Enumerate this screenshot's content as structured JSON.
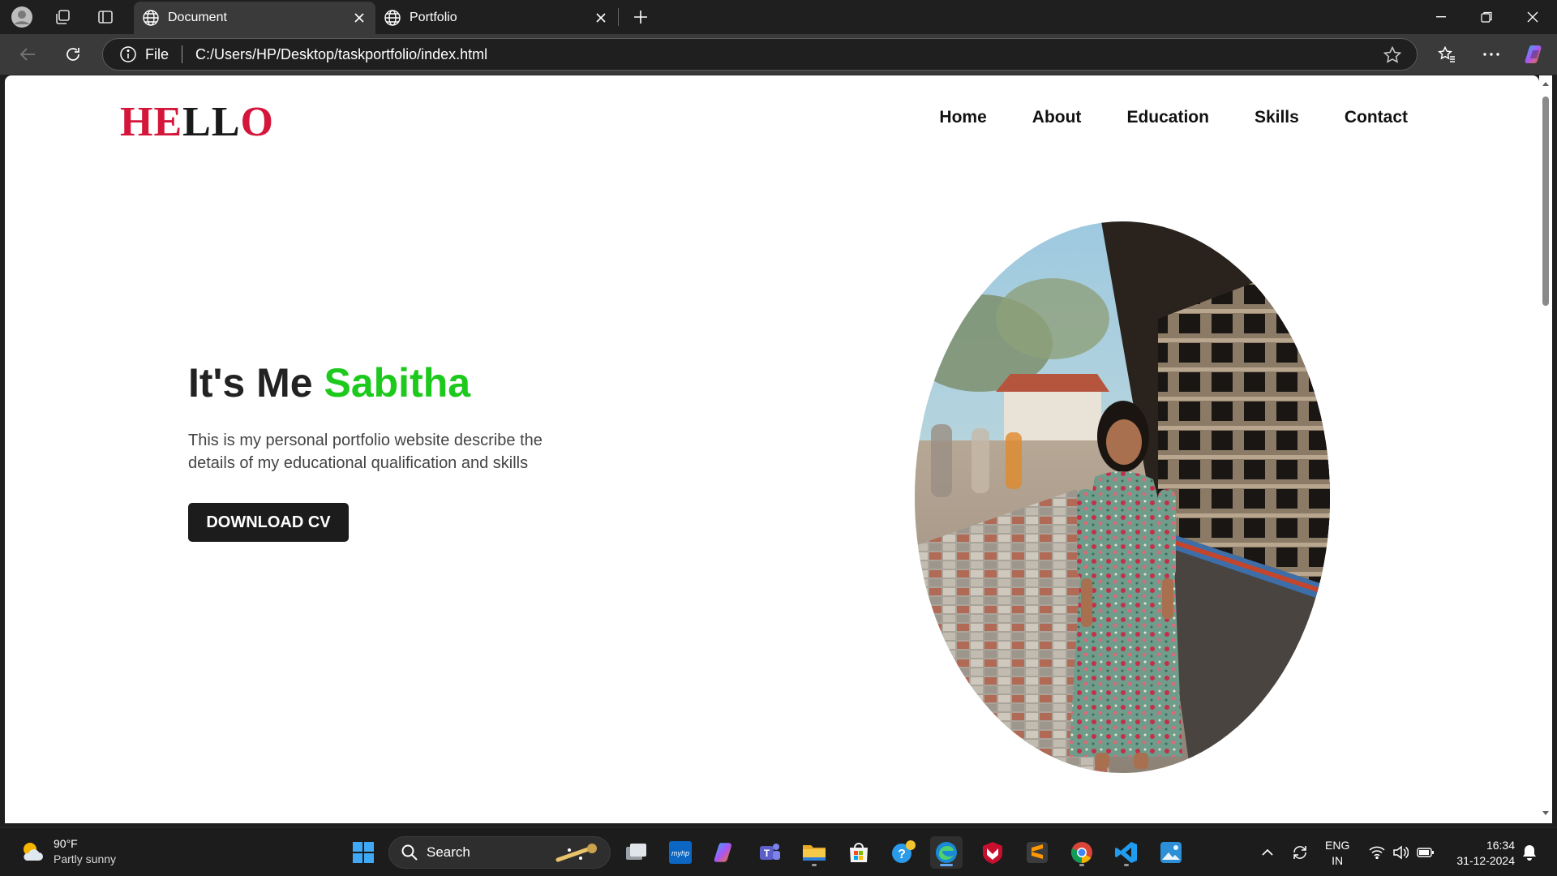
{
  "browser": {
    "tabs": [
      {
        "title": "Document",
        "active": true
      },
      {
        "title": "Portfolio",
        "active": false
      }
    ],
    "address": {
      "scheme_label": "File",
      "url": "C:/Users/HP/Desktop/taskportfolio/index.html"
    },
    "icons": [
      "profile-icon",
      "workspaces-icon",
      "tab-actions-icon",
      "back-icon",
      "refresh-icon",
      "info-icon",
      "favorite-star-icon",
      "favorites-icon",
      "more-icon",
      "copilot-icon",
      "minimize-icon",
      "restore-icon",
      "close-icon"
    ]
  },
  "page": {
    "logo": {
      "part1": "HE",
      "part2": "LL",
      "part3": "O"
    },
    "nav": [
      "Home",
      "About",
      "Education",
      "Skills",
      "Contact"
    ],
    "hero": {
      "title_prefix": "It's Me ",
      "title_name": "Sabitha",
      "description": "This is my personal portfolio website describe the details of my educational qualification and skills",
      "button": "DOWNLOAD CV"
    },
    "colors": {
      "logo_red": "#d4163b",
      "accent_green": "#1cc91c",
      "button_bg": "#1c1c1c"
    }
  },
  "taskbar": {
    "weather": {
      "temp": "90°F",
      "condition": "Partly sunny"
    },
    "search_placeholder": "Search",
    "language": {
      "line1": "ENG",
      "line2": "IN"
    },
    "clock": {
      "time": "16:34",
      "date": "31-12-2024"
    }
  }
}
